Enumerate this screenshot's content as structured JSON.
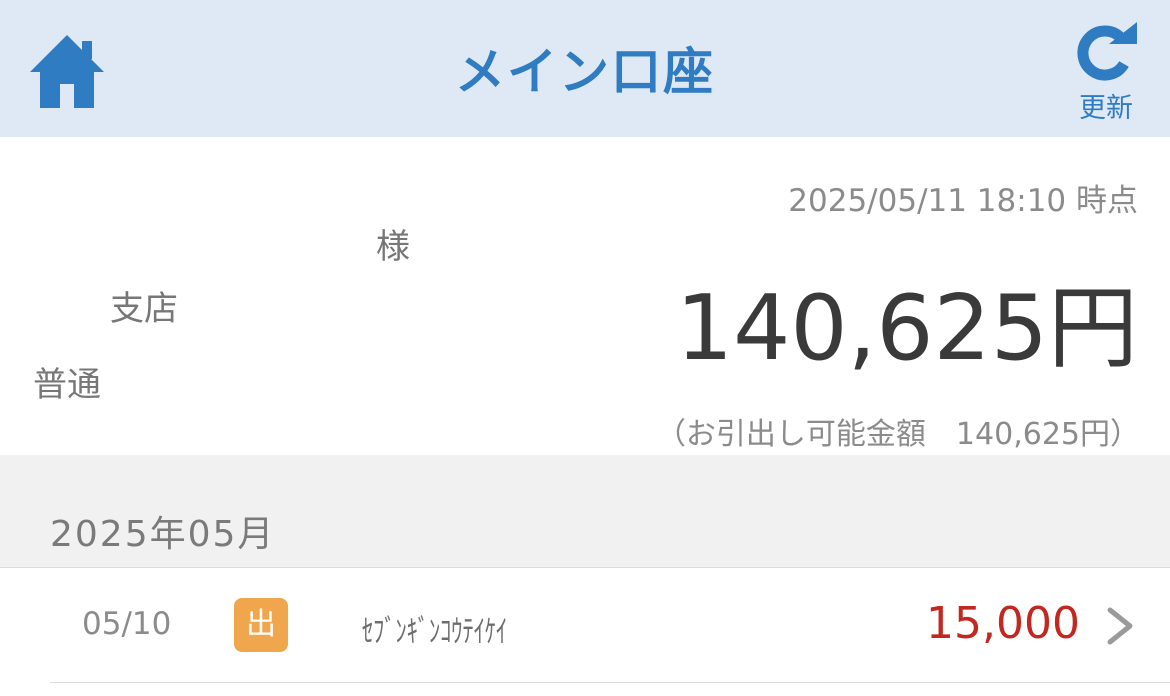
{
  "header": {
    "title": "メイン口座",
    "refresh_label": "更新",
    "home_icon": "home-icon",
    "refresh_icon": "refresh-icon",
    "accent_color": "#2f7cc2",
    "background_color": "#dfe9f5"
  },
  "account": {
    "timestamp": "2025/05/11 18:10 時点",
    "holder_suffix": "様",
    "branch_suffix": "支店",
    "account_type": "普通",
    "balance": "140,625円",
    "withdrawable": "（お引出し可能金額　140,625円）"
  },
  "transactions": {
    "month_label": "2025年05月",
    "items": [
      {
        "date": "05/10",
        "type_badge": "出",
        "description": "ｾﾌﾞﾝｷﾞﾝｺｳﾃｲｹｲ",
        "amount": "15,000",
        "amount_color": "#c2281f",
        "badge_color": "#f0a64c"
      }
    ]
  }
}
